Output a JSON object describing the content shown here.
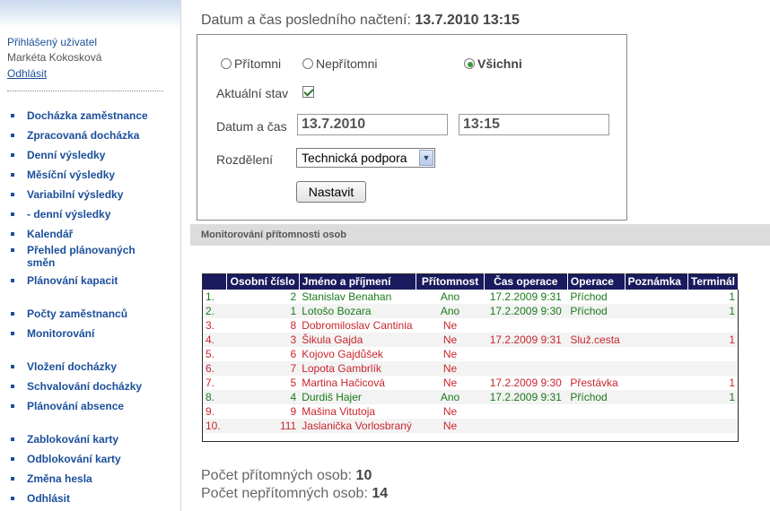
{
  "sidebar": {
    "user_heading": "Přihlášený uživatel",
    "user_name": "Markéta Kokosková",
    "logout_link": "Odhlásit",
    "items": [
      {
        "label": "Docházka zaměstnance"
      },
      {
        "label": "Zpracovaná docházka"
      },
      {
        "label": "Denní výsledky"
      },
      {
        "label": "Měsíční výsledky"
      },
      {
        "label": "Variabilní výsledky"
      },
      {
        "label": "- denní výsledky"
      },
      {
        "label": "Kalendář"
      },
      {
        "label": "Přehled plánovaných směn"
      },
      {
        "label": "Plánování kapacit"
      },
      {
        "label": "Počty zaměstnanců"
      },
      {
        "label": "Monitorování"
      },
      {
        "label": "Vložení docházky"
      },
      {
        "label": "Schvalování docházky"
      },
      {
        "label": "Plánování absence"
      },
      {
        "label": "Zablokování karty"
      },
      {
        "label": "Odblokování karty"
      },
      {
        "label": "Změna hesla"
      },
      {
        "label": "Odhlásit"
      }
    ]
  },
  "header": {
    "last_load_label": "Datum a čas posledního načtení:",
    "last_load_value": "13.7.2010 13:15"
  },
  "filter": {
    "radio_present": "Přítomni",
    "radio_absent": "Nepřítomni",
    "radio_all": "Všichni",
    "selected_radio": "all",
    "current_state_label": "Aktuální stav",
    "current_state_checked": true,
    "datetime_label": "Datum a čas",
    "date_value": "13.7.2010",
    "time_value": "13:15",
    "division_label": "Rozdělení",
    "division_value": "Technická podpora",
    "set_button": "Nastavit"
  },
  "section": {
    "title": "Monitorování přítomnosti osob"
  },
  "table": {
    "headers": [
      "",
      "Osobní číslo",
      "Jméno a příjmení",
      "Přítomnost",
      "Čas operace",
      "Operace",
      "Poznámka",
      "Terminál"
    ],
    "rows": [
      {
        "no": "1.",
        "id": "2",
        "name": "Stanislav Benahan",
        "presence": "Ano",
        "time": "17.2.2009 9:31",
        "operation": "Příchod",
        "note": "",
        "terminal": "1",
        "status": "present"
      },
      {
        "no": "2.",
        "id": "1",
        "name": "Lotošo Bozara",
        "presence": "Ano",
        "time": "17.2.2009 9:30",
        "operation": "Příchod",
        "note": "",
        "terminal": "1",
        "status": "present"
      },
      {
        "no": "3.",
        "id": "8",
        "name": "Dobromiloslav Cantinia",
        "presence": "Ne",
        "time": "",
        "operation": "",
        "note": "",
        "terminal": "",
        "status": "absent"
      },
      {
        "no": "4.",
        "id": "3",
        "name": "Šikula Gajda",
        "presence": "Ne",
        "time": "17.2.2009 9:31",
        "operation": "Služ.cesta",
        "note": "",
        "terminal": "1",
        "status": "absent"
      },
      {
        "no": "5.",
        "id": "6",
        "name": "Kojovo Gajdůšek",
        "presence": "Ne",
        "time": "",
        "operation": "",
        "note": "",
        "terminal": "",
        "status": "absent"
      },
      {
        "no": "6.",
        "id": "7",
        "name": "Lopota Gambrlík",
        "presence": "Ne",
        "time": "",
        "operation": "",
        "note": "",
        "terminal": "",
        "status": "absent"
      },
      {
        "no": "7.",
        "id": "5",
        "name": "Martina Hačicová",
        "presence": "Ne",
        "time": "17.2.2009 9:30",
        "operation": "Přestávka",
        "note": "",
        "terminal": "1",
        "status": "absent"
      },
      {
        "no": "8.",
        "id": "4",
        "name": "Durdiš Hajer",
        "presence": "Ano",
        "time": "17.2.2009 9:31",
        "operation": "Příchod",
        "note": "",
        "terminal": "1",
        "status": "present"
      },
      {
        "no": "9.",
        "id": "9",
        "name": "Mašina Vitutoja",
        "presence": "Ne",
        "time": "",
        "operation": "",
        "note": "",
        "terminal": "",
        "status": "absent"
      },
      {
        "no": "10.",
        "id": "111",
        "name": "Jaslanička Vorlosbraný",
        "presence": "Ne",
        "time": "",
        "operation": "",
        "note": "",
        "terminal": "",
        "status": "absent"
      }
    ]
  },
  "summary": {
    "present_label": "Počet přítomných osob:",
    "present_value": "10",
    "absent_label": "Počet nepřítomných osob:",
    "absent_value": "14"
  },
  "colors": {
    "nav_blue": "#1b4f9b",
    "header_navy": "#1a1a5e",
    "present_green": "#1a7a1a",
    "absent_red": "#c8262e"
  }
}
